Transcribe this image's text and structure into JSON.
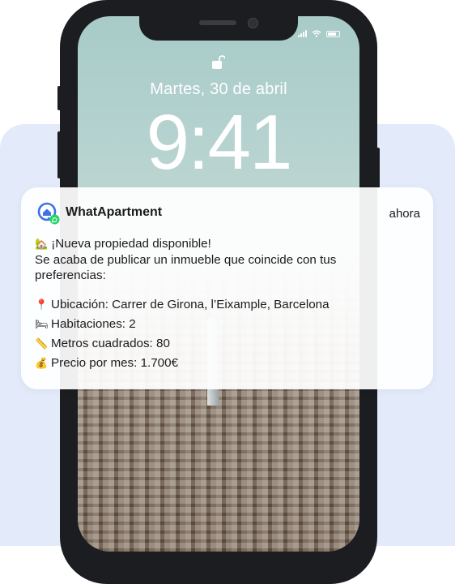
{
  "lockscreen": {
    "date": "Martes, 30 de abril",
    "time": "9:41"
  },
  "notification": {
    "app_name": "WhatApartment",
    "time": "ahora",
    "headline_emoji": "🏡",
    "headline": "¡Nueva propiedad disponible!",
    "message_line1": "Se acaba de publicar un inmueble que coincide con tus",
    "message_line2": "preferencias:",
    "details": [
      {
        "icon": "pin-icon",
        "emoji": "📍",
        "text": "Ubicación: Carrer de Girona, l’Eixample, Barcelona"
      },
      {
        "icon": "bed-icon",
        "emoji": "🛏",
        "text": "Habitaciones: 2"
      },
      {
        "icon": "ruler-icon",
        "emoji": "📏",
        "text": "Metros cuadrados: 80"
      },
      {
        "icon": "money-bag-icon",
        "emoji": "💰",
        "text": "Precio por mes: 1.700€"
      }
    ]
  },
  "colors": {
    "background_card": "#e3ebfb",
    "phone_frame": "#1b1d21",
    "brand_blue": "#3b73e6",
    "whatsapp_green": "#25d366"
  }
}
